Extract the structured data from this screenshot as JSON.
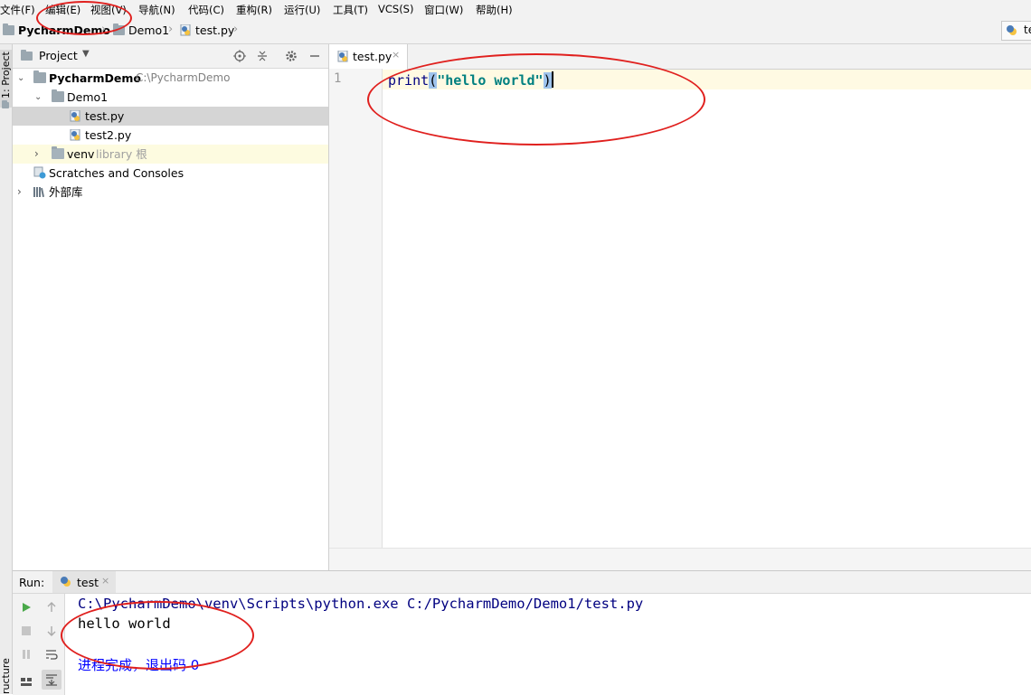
{
  "menu": [
    "文件(F)",
    "编辑(E)",
    "视图(V)",
    "导航(N)",
    "代码(C)",
    "重构(R)",
    "运行(U)",
    "工具(T)",
    "VCS(S)",
    "窗口(W)",
    "帮助(H)"
  ],
  "breadcrumb": {
    "root": "PycharmDemo",
    "folder": "Demo1",
    "file": "test.py",
    "right_tab": "te"
  },
  "left_strip": {
    "project_label": "1: Project",
    "structure_label": "ructure"
  },
  "project_panel": {
    "title": "Project",
    "tree": {
      "root_name": "PycharmDemo",
      "root_path": "C:\\PycharmDemo",
      "folder": "Demo1",
      "file1": "test.py",
      "file2": "test2.py",
      "venv": "venv",
      "venv_note": "library 根",
      "scratches": "Scratches and Consoles",
      "external": "外部库"
    }
  },
  "editor": {
    "tab": "test.py",
    "line_number": "1",
    "code": {
      "fn": "print",
      "open": "(",
      "str": "\"hello world\"",
      "close": ")"
    }
  },
  "run": {
    "label": "Run:",
    "tab": "test",
    "output_cmd": "C:\\PycharmDemo\\venv\\Scripts\\python.exe C:/PycharmDemo/Demo1/test.py",
    "output_text": "hello world",
    "output_exit": "进程完成，退出码 0"
  },
  "colors": {
    "annotation": "#e0201e",
    "code_fn": "#000080",
    "code_str": "#008080",
    "console_cmd": "#000080",
    "exit_text": "#0000ff"
  }
}
